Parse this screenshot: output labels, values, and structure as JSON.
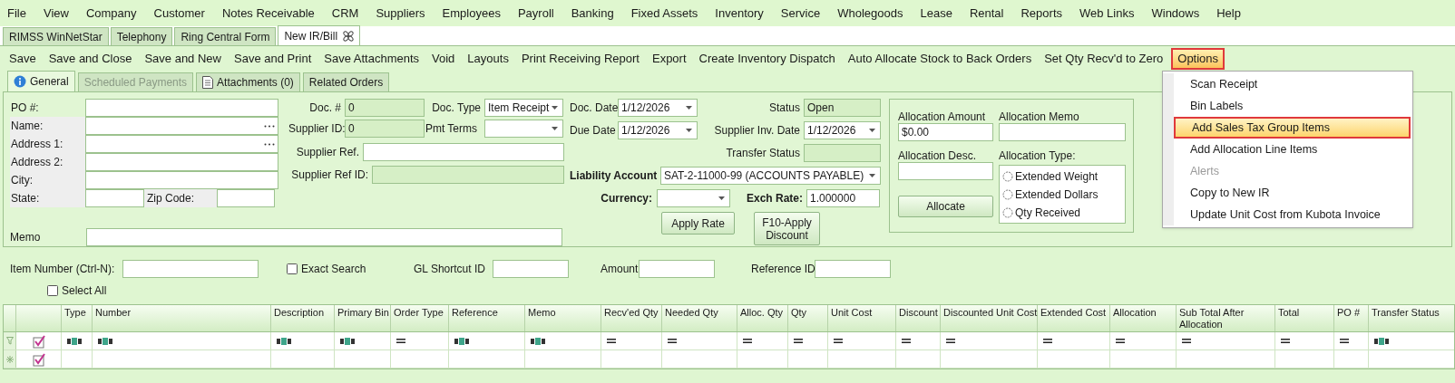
{
  "menu_bar": [
    "File",
    "View",
    "Company",
    "Customer",
    "Notes Receivable",
    "CRM",
    "Suppliers",
    "Employees",
    "Payroll",
    "Banking",
    "Fixed Assets",
    "Inventory",
    "Service",
    "Wholegoods",
    "Lease",
    "Rental",
    "Reports",
    "Web Links",
    "Windows",
    "Help"
  ],
  "document_tabs": [
    {
      "label": "RIMSS WinNetStar",
      "selected": false,
      "closable": false
    },
    {
      "label": "Telephony",
      "selected": false,
      "closable": false
    },
    {
      "label": "Ring Central Form",
      "selected": false,
      "closable": false
    },
    {
      "label": "New IR/Bill",
      "selected": true,
      "closable": true
    }
  ],
  "toolbar": [
    {
      "label": "Save",
      "selected": false
    },
    {
      "label": "Save and Close",
      "selected": false
    },
    {
      "label": "Save and New",
      "selected": false
    },
    {
      "label": "Save and Print",
      "selected": false
    },
    {
      "label": "Save Attachments",
      "selected": false
    },
    {
      "label": "Void",
      "selected": false
    },
    {
      "label": "Layouts",
      "selected": false
    },
    {
      "label": "Print Receiving Report",
      "selected": false
    },
    {
      "label": "Export",
      "selected": false
    },
    {
      "label": "Create Inventory Dispatch",
      "selected": false
    },
    {
      "label": "Auto Allocate Stock to Back Orders",
      "selected": false
    },
    {
      "label": "Set Qty Recv'd to Zero",
      "selected": false
    },
    {
      "label": "Options",
      "selected": true
    }
  ],
  "form_tabs": [
    {
      "label": "General",
      "selected": true,
      "disabled": false,
      "kind": "info"
    },
    {
      "label": "Scheduled Payments",
      "selected": false,
      "disabled": true,
      "kind": "plain"
    },
    {
      "label": "Attachments (0)",
      "selected": false,
      "disabled": false,
      "kind": "document"
    },
    {
      "label": "Related Orders",
      "selected": false,
      "disabled": false,
      "kind": "plain"
    }
  ],
  "address_fields": [
    {
      "label": "PO #:",
      "shaded": false,
      "lookup": false
    },
    {
      "label": "Name:",
      "shaded": true,
      "lookup": true
    },
    {
      "label": "Address 1:",
      "shaded": true,
      "lookup": true
    },
    {
      "label": "Address 2:",
      "shaded": true,
      "lookup": false
    },
    {
      "label": "City:",
      "shaded": true,
      "lookup": false
    }
  ],
  "state": {
    "label": "State:"
  },
  "zip_code": {
    "label": "Zip Code:"
  },
  "memo": {
    "label": "Memo"
  },
  "doc_number": {
    "label": "Doc. #",
    "value": "0",
    "readonly": true
  },
  "supplier_id": {
    "label": "Supplier ID:",
    "value": "0",
    "readonly": true
  },
  "doc_type": {
    "label": "Doc. Type",
    "value": "Item Receipt"
  },
  "pmt_terms": {
    "label": "Pmt Terms"
  },
  "supplier_ref": {
    "label": "Supplier Ref.",
    "readonly": false
  },
  "supplier_ref_id": {
    "label": "Supplier Ref ID:",
    "readonly": true
  },
  "doc_date": {
    "label": "Doc. Date",
    "value": "1/12/2026"
  },
  "due_date": {
    "label": "Due Date",
    "value": "1/12/2026"
  },
  "status": {
    "label": "Status",
    "value": "Open",
    "readonly": true
  },
  "supplier_inv_date": {
    "label": "Supplier Inv. Date",
    "value": "1/12/2026"
  },
  "transfer_status": {
    "label": "Transfer Status",
    "readonly": true
  },
  "liability_account": {
    "label": "Liability Account",
    "value": "SAT-2-11000-99 (ACCOUNTS PAYABLE)"
  },
  "currency": {
    "label": "Currency:"
  },
  "exch_rate": {
    "label": "Exch Rate:",
    "value": "1.000000"
  },
  "apply_rate_button": "Apply Rate",
  "apply_discount_button": "F10-Apply Discount",
  "allocation": {
    "amount_label": "Allocation Amount",
    "amount": "$0.00",
    "memo_label": "Allocation Memo",
    "desc_label": "Allocation Desc.",
    "type_label": "Allocation Type:",
    "button": "Allocate",
    "types": [
      {
        "label": "Extended Weight",
        "selected": false
      },
      {
        "label": "Extended Dollars",
        "selected": false
      },
      {
        "label": "Qty Received",
        "selected": false
      }
    ]
  },
  "search": {
    "item_number_label": "Item Number (Ctrl-N):",
    "exact_search": {
      "label": "Exact Search",
      "checked": false
    },
    "gl_shortcut_label": "GL Shortcut ID",
    "amount_label": "Amount",
    "reference_label": "Reference ID",
    "select_all": {
      "label": "Select All",
      "checked": false
    }
  },
  "grid": {
    "columns": [
      {
        "label": "Type",
        "kind": "text"
      },
      {
        "label": "Number",
        "kind": "text"
      },
      {
        "label": "Description",
        "kind": "text"
      },
      {
        "label": "Primary Bin",
        "kind": "text"
      },
      {
        "label": "Order Type",
        "kind": "number"
      },
      {
        "label": "Reference",
        "kind": "text"
      },
      {
        "label": "Memo",
        "kind": "text"
      },
      {
        "label": "Recv'ed Qty",
        "kind": "number"
      },
      {
        "label": "Needed Qty",
        "kind": "number"
      },
      {
        "label": "Alloc. Qty",
        "kind": "number"
      },
      {
        "label": "Qty",
        "kind": "number"
      },
      {
        "label": "Unit Cost",
        "kind": "number"
      },
      {
        "label": "Discount",
        "kind": "number"
      },
      {
        "label": "Discounted Unit Cost",
        "kind": "number"
      },
      {
        "label": "Extended Cost",
        "kind": "number"
      },
      {
        "label": "Allocation",
        "kind": "number"
      },
      {
        "label": "Sub Total After Allocation",
        "kind": "number"
      },
      {
        "label": "Total",
        "kind": "number"
      },
      {
        "label": "PO #",
        "kind": "number"
      },
      {
        "label": "Transfer Status",
        "kind": "text"
      }
    ]
  },
  "options_menu": [
    {
      "label": "Scan Receipt",
      "selected": false,
      "disabled": false
    },
    {
      "label": "Bin Labels",
      "selected": false,
      "disabled": false
    },
    {
      "label": "Add Sales Tax Group Items",
      "selected": true,
      "disabled": false
    },
    {
      "label": "Add Allocation Line Items",
      "selected": false,
      "disabled": false
    },
    {
      "label": "Alerts",
      "selected": false,
      "disabled": true
    },
    {
      "label": "Copy to New IR",
      "selected": false,
      "disabled": false
    },
    {
      "label": "Update Unit Cost from Kubota Invoice",
      "selected": false,
      "disabled": false
    }
  ]
}
